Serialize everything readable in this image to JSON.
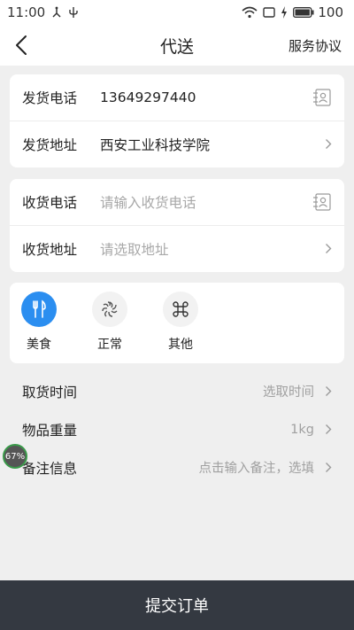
{
  "status_bar": {
    "time": "11:00",
    "battery_level": "100"
  },
  "nav": {
    "title": "代送",
    "action_label": "服务协议"
  },
  "sender": {
    "phone_label": "发货电话",
    "phone_value": "13649297440",
    "address_label": "发货地址",
    "address_value": "西安工业科技学院"
  },
  "receiver": {
    "phone_label": "收货电话",
    "phone_placeholder": "请输入收货电话",
    "address_label": "收货地址",
    "address_placeholder": "请选取地址"
  },
  "categories": [
    {
      "label": "美食",
      "icon": "fork-knife-icon",
      "selected": true
    },
    {
      "label": "正常",
      "icon": "spinner-icon",
      "selected": false
    },
    {
      "label": "其他",
      "icon": "command-icon",
      "selected": false
    }
  ],
  "details": {
    "pickup_time_label": "取货时间",
    "pickup_time_value": "选取时间",
    "weight_label": "物品重量",
    "weight_value": "1kg",
    "note_label": "备注信息",
    "note_value": "点击输入备注，选填"
  },
  "float_badge": "67%",
  "submit_label": "提交订单",
  "colors": {
    "accent": "#2b8ef0",
    "submit_bg": "#343941",
    "page_bg": "#efefef"
  }
}
